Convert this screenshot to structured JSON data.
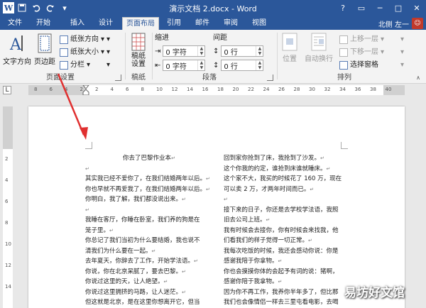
{
  "window": {
    "title": "演示文档 2.docx - Word",
    "controls": [
      "?",
      "▭",
      "─",
      "□",
      "✕"
    ]
  },
  "qat": {
    "app_logo": "W",
    "save": "save-icon",
    "undo": "undo-icon",
    "redo": "redo-icon"
  },
  "tabs": [
    {
      "label": "文件"
    },
    {
      "label": "开始"
    },
    {
      "label": "插入"
    },
    {
      "label": "设计"
    },
    {
      "label": "页面布局",
      "active": true
    },
    {
      "label": "引用"
    },
    {
      "label": "邮件"
    },
    {
      "label": "审阅"
    },
    {
      "label": "视图"
    }
  ],
  "user": {
    "name": "北侧 左一",
    "avatar_color": "#c0392b"
  },
  "ribbon": {
    "page_setup": {
      "label": "页面设置",
      "text_direction": "文字方向",
      "margins": "页边距",
      "orientation": "纸张方向",
      "size": "纸张大小",
      "columns": "分栏"
    },
    "manuscript": {
      "label": "稿纸",
      "settings": "稿纸\n设置"
    },
    "paragraph": {
      "label": "段落",
      "indent_header": "缩进",
      "spacing_header": "间距",
      "indent_left": "0 字符",
      "indent_right": "0 字符",
      "spacing_before": "0 行",
      "spacing_after": "0 行"
    },
    "arrange": {
      "label": "排列",
      "position": "位置",
      "wrap_text": "自动换行",
      "bring_forward": "上移一层",
      "send_backward": "下移一层",
      "selection_pane": "选择窗格"
    }
  },
  "ruler": {
    "corner": "L",
    "h_numbers": [
      "8",
      "6",
      "4",
      "2",
      "2",
      "4",
      "6",
      "8",
      "10",
      "12",
      "14",
      "16",
      "18",
      "20",
      "22",
      "24",
      "26",
      "28",
      "30",
      "32",
      "34",
      "36",
      "38",
      "40"
    ],
    "v_numbers": [
      "2",
      "4",
      "6",
      "8",
      "10",
      "12",
      "14"
    ]
  },
  "document": {
    "left_column": [
      "你去了巴黎作业本↵",
      "↵",
      "其实我已经不爱你了，在我们结婚两年以后。↵",
      "你也早就不再爱我了，在我们结婚两年以后。↵",
      "你明白，我了解，我们都没说出来。↵",
      "↵",
      "我睡在客厅，你睡在卧室，我们养的狗是在",
      "笼子里。↵",
      "你总记了我们当初为什么要结婚，我也说不",
      "清我们为什么要在一起。↵",
      "去年夏天，你辞去了工作，开始学法语。↵",
      "你说，你在北京呆腻了，要去巴黎。↵",
      "你说过这里的天，让人绝望。↵",
      "你说过这里拥挤的马路，让人迷茫。↵",
      "但这就是北京，是在这里你想离开它，但当"
    ],
    "right_column": [
      "回到家你抢到了床，我抢到了沙发。↵",
      "这个你我的约定，谁抢到床谁就睡床。↵",
      "这个家不大，我买的时候花了 160 万，现在",
      "可以卖 2 万，才两年时间而已。↵",
      "↵",
      "接下来的日子，你还是去学校学法语，我照",
      "旧去公司上班。↵",
      "我有时候会去接你，你有时候会来找我，他",
      "们看我们的样子觉得一切正常。↵",
      "我每次吃饭的时候，我还会感动你说：你是",
      "感谢我陪于你拿物。↵",
      "你也会摸摸你体的会起予有词的说：猪啊，",
      "感谢你陪于我拿物。↵",
      "因为你不再工作，我养你半年多了，但比那",
      "我们也会像情侣一样去三里屯看电影，去喝"
    ]
  },
  "watermark": "易坊好文馆",
  "colors": {
    "accent": "#2b579a",
    "annotation_arrow": "#e03030"
  }
}
